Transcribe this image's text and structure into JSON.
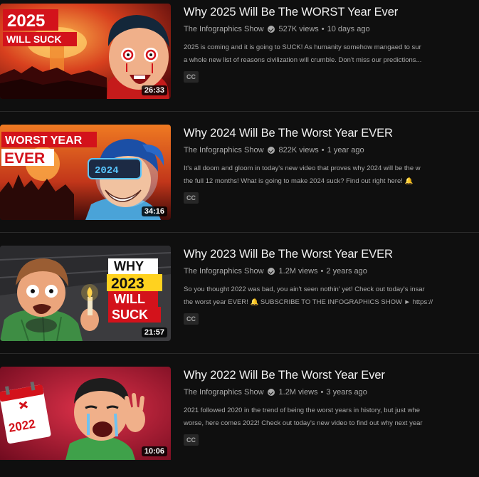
{
  "videos": [
    {
      "title": "Why 2025 Will Be The WORST Year Ever",
      "channel": "The Infographics Show",
      "views": "527K views",
      "age": "10 days ago",
      "desc_line1": "2025 is coming and it is going to SUCK! As humanity somehow mangaed to sur",
      "desc_line2": "a whole new list of reasons civilization will crumble. Don't miss our predictions...",
      "badge": "CC",
      "duration": "26:33",
      "thumb_text1": "2025",
      "thumb_text2": "WILL SUCK"
    },
    {
      "title": "Why 2024 Will Be The Worst Year EVER",
      "channel": "The Infographics Show",
      "views": "822K views",
      "age": "1 year ago",
      "desc_line1": "It's all doom and gloom in today's new video that proves why 2024 will be the w",
      "desc_line2": "the full 12 months! What is going to make 2024 suck? Find out right here! 🔔",
      "badge": "CC",
      "duration": "34:16",
      "thumb_text1": "WORST YEAR",
      "thumb_text2": "EVER",
      "thumb_text3": "2024"
    },
    {
      "title": "Why 2023 Will Be The Worst Year EVER",
      "channel": "The Infographics Show",
      "views": "1.2M views",
      "age": "2 years ago",
      "desc_line1": "So you thought 2022 was bad, you ain't seen nothin' yet! Check out today's insar",
      "desc_line2": "the worst year EVER! 🔔 SUBSCRIBE TO THE INFOGRAPHICS SHOW ► https://",
      "badge": "CC",
      "duration": "21:57",
      "thumb_text1": "WHY",
      "thumb_text2": "2023",
      "thumb_text3": "WILL",
      "thumb_text4": "SUCK"
    },
    {
      "title": "Why 2022 Will Be The Worst Year Ever",
      "channel": "The Infographics Show",
      "views": "1.2M views",
      "age": "3 years ago",
      "desc_line1": "2021 followed 2020 in the trend of being the worst years in history, but just whe",
      "desc_line2": "worse, here comes 2022! Check out today's new video to find out why next year",
      "badge": "CC",
      "duration": "10:06",
      "thumb_text1": "2022"
    }
  ],
  "separator": "•"
}
